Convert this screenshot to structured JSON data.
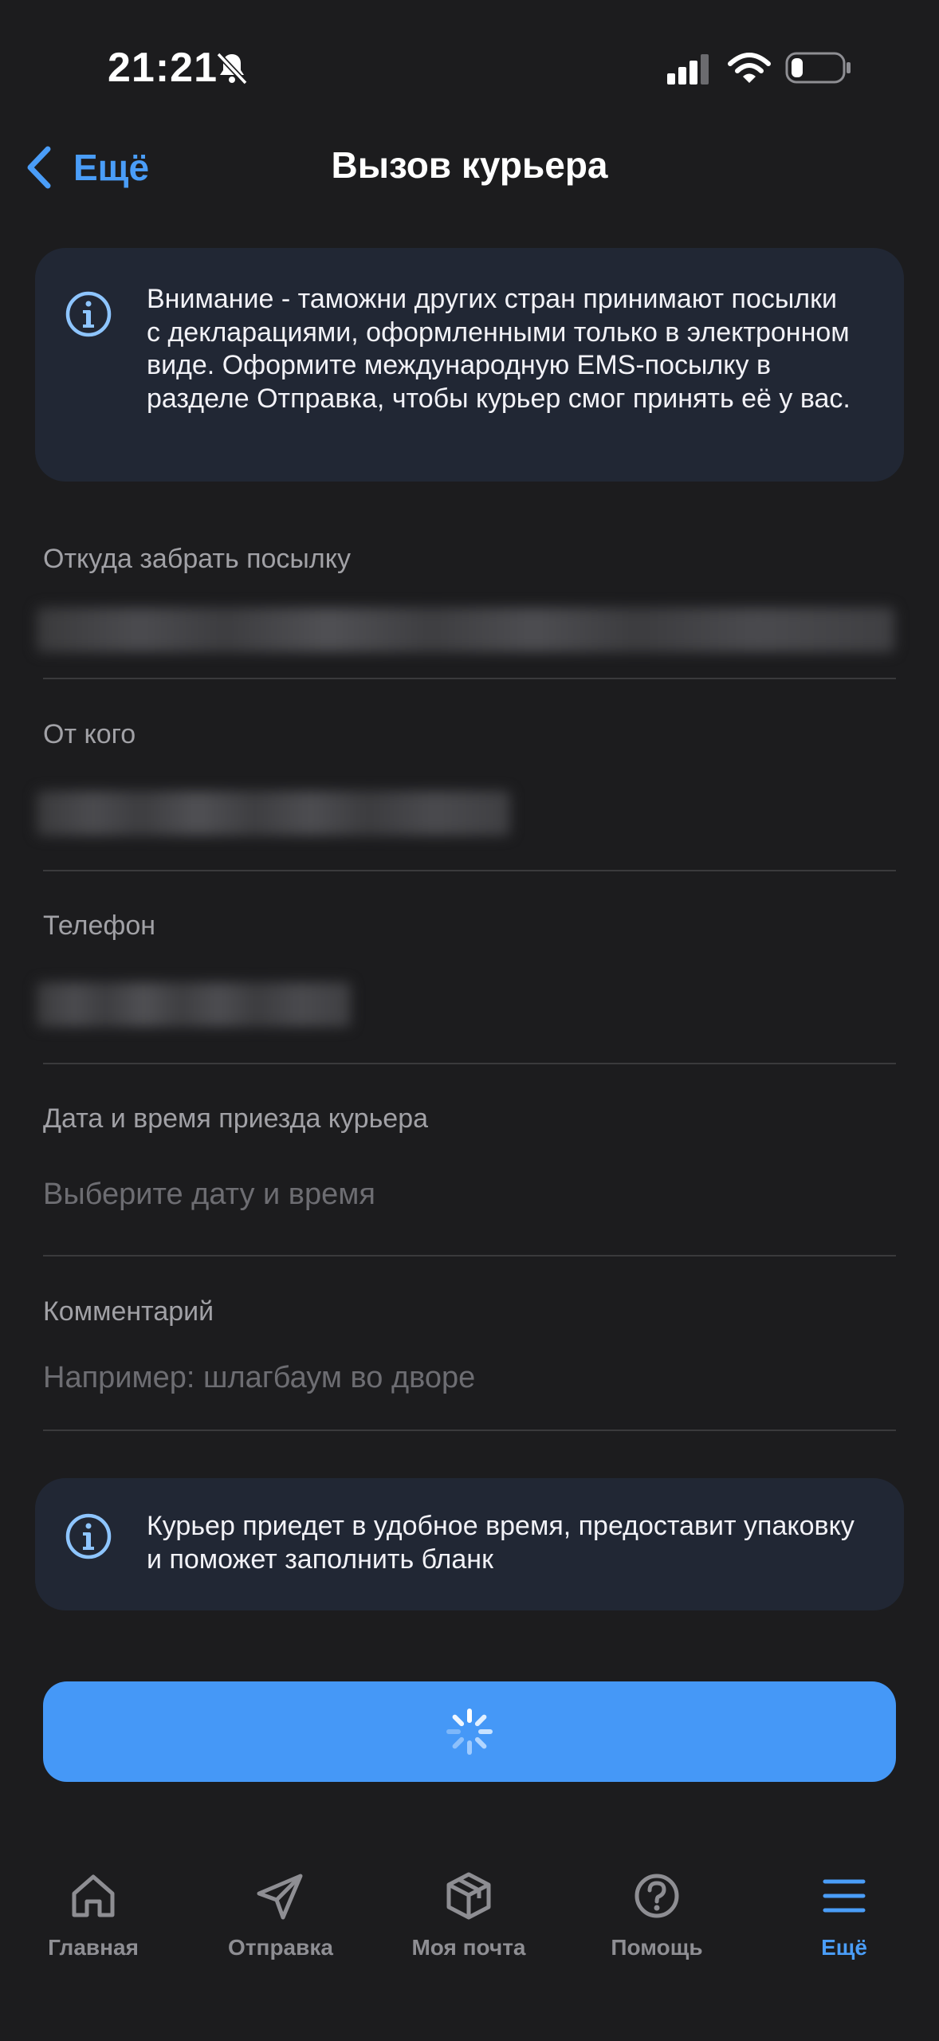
{
  "status_bar": {
    "time": "21:21"
  },
  "nav": {
    "back_label": "Ещё",
    "title": "Вызов курьера"
  },
  "notice_top": "Внимание - таможни других стран принимают посылки с декларациями, оформленными только в электронном виде. Оформите международную EMS-посылку в разделе Отправка, чтобы курьер смог принять её у вас.",
  "form": {
    "pickup_label": "Откуда забрать посылку",
    "sender_label": "От кого",
    "phone_label": "Телефон",
    "datetime_label": "Дата и время приезда курьера",
    "datetime_placeholder": "Выберите дату и время",
    "comment_label": "Комментарий",
    "comment_placeholder": "Например: шлагбаум во дворе"
  },
  "notice_bottom": "Курьер приедет в удобное время, предоставит упаковку и поможет заполнить бланк",
  "tabs": [
    {
      "label": "Главная",
      "icon": "home-icon",
      "active": false
    },
    {
      "label": "Отправка",
      "icon": "send-icon",
      "active": false
    },
    {
      "label": "Моя почта",
      "icon": "box-icon",
      "active": false
    },
    {
      "label": "Помощь",
      "icon": "help-icon",
      "active": false
    },
    {
      "label": "Ещё",
      "icon": "menu-icon",
      "active": true
    }
  ],
  "colors": {
    "accent": "#4a9df8",
    "button": "#4598f7",
    "background": "#1c1c1e",
    "card": "#212734"
  }
}
